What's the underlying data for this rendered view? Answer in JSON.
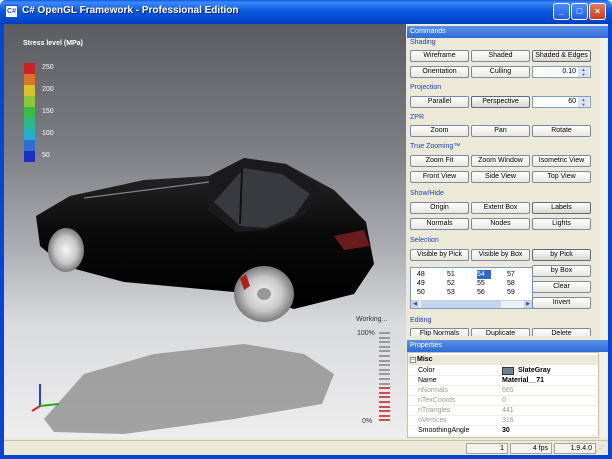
{
  "window": {
    "title": "C# OpenGL Framework - Professional Edition",
    "minimize": "_",
    "maximize": "□",
    "close": "×"
  },
  "viewport": {
    "legend_title": "Stress level (MPa)",
    "legend": [
      {
        "label": "250",
        "color": "#cc2222"
      },
      {
        "label": "",
        "color": "#d8742a"
      },
      {
        "label": "200",
        "color": "#d6c42c"
      },
      {
        "label": "",
        "color": "#8cc63c"
      },
      {
        "label": "150",
        "color": "#3cba48"
      },
      {
        "label": "",
        "color": "#2cb88c"
      },
      {
        "label": "100",
        "color": "#24aecc"
      },
      {
        "label": "",
        "color": "#2a6fd0"
      },
      {
        "label": "50",
        "color": "#1e2ec0"
      }
    ],
    "working_label": "Working...",
    "progress_top": "100%",
    "progress_bottom": "0%",
    "progress_fraction": 0.42
  },
  "commands": {
    "header": "Commands",
    "shading": {
      "title": "Shading",
      "wireframe": "Wireframe",
      "shaded": "Shaded",
      "shaded_edges": "Shaded & Edges",
      "orientation": "Orientation",
      "culling": "Culling",
      "value": "0.10"
    },
    "projection": {
      "title": "Projection",
      "parallel": "Parallel",
      "perspective": "Perspective",
      "value": "60"
    },
    "zpr": {
      "title": "ZPR",
      "zoom": "Zoom",
      "pan": "Pan",
      "rotate": "Rotate"
    },
    "true_zooming": {
      "title": "True Zooming™",
      "zoom_fit": "Zoom Fit",
      "zoom_window": "Zoom Window",
      "isometric": "Isometric View",
      "front": "Front View",
      "side": "Side View",
      "top": "Top View"
    },
    "show_hide": {
      "title": "Show/Hide",
      "origin": "Origin",
      "extent_box": "Extent Box",
      "labels": "Labels",
      "normals": "Normals",
      "nodes": "Nodes",
      "lights": "Lights"
    },
    "selection": {
      "title": "Selection",
      "visible_by_pick": "Visible by Pick",
      "visible_by_box": "Visible by Box",
      "by_pick": "by Pick",
      "by_box": "by Box",
      "clear": "Clear",
      "invert": "Invert",
      "rows": [
        [
          "48",
          "51",
          "54",
          "57"
        ],
        [
          "49",
          "52",
          "55",
          "58"
        ],
        [
          "50",
          "53",
          "56",
          "59"
        ]
      ]
    },
    "editing": {
      "title": "Editing",
      "flip_normals": "Flip Normals",
      "duplicate": "Duplicate",
      "delete": "Delete"
    }
  },
  "properties": {
    "header": "Properties",
    "group": "Misc",
    "rows": [
      {
        "name": "Color",
        "value": "SlateGray"
      },
      {
        "name": "Name",
        "value": "Material__71"
      },
      {
        "name": "nNormals",
        "value": "665"
      },
      {
        "name": "nTexCoords",
        "value": "0"
      },
      {
        "name": "nTriangles",
        "value": "441"
      },
      {
        "name": "nVertices",
        "value": "316"
      },
      {
        "name": "SmoothingAngle",
        "value": "30"
      }
    ],
    "swatch_color": "#708090"
  },
  "status": {
    "count": "1",
    "fps": "4 fps",
    "version": "1.9.4.0"
  }
}
